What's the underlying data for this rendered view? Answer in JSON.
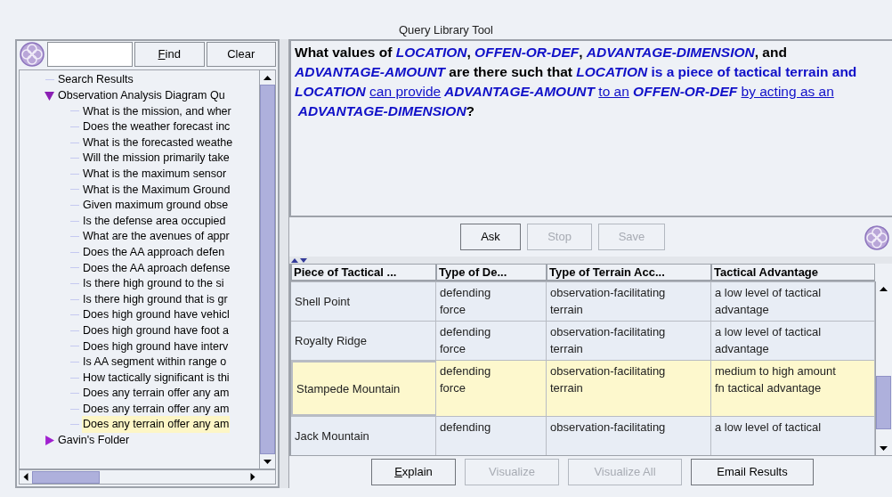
{
  "window": {
    "title": "Query Library Tool"
  },
  "search": {
    "buttons": [
      {
        "label": "Find",
        "mnemonic": true
      },
      {
        "label": "Clear",
        "mnemonic": false
      }
    ]
  },
  "tree": [
    {
      "label": "Search Results",
      "kind": "leaf",
      "selected": false
    },
    {
      "label": "Observation Analysis Diagram Qu",
      "kind": "folder",
      "expanded": true,
      "selected": false,
      "children": [
        {
          "label": "What is the mission, and wher",
          "kind": "leaf",
          "selected": false
        },
        {
          "label": "Does the weather forecast inc",
          "kind": "leaf",
          "selected": false
        },
        {
          "label": "What is the forecasted weathe",
          "kind": "leaf",
          "selected": false
        },
        {
          "label": "Will the mission primarily take",
          "kind": "leaf",
          "selected": false
        },
        {
          "label": "What is the maximum sensor",
          "kind": "leaf",
          "selected": false
        },
        {
          "label": "What is the Maximum Ground",
          "kind": "leaf",
          "selected": false
        },
        {
          "label": "Given maximum ground obse",
          "kind": "leaf",
          "selected": false
        },
        {
          "label": "Is the defense area occupied",
          "kind": "leaf",
          "selected": false
        },
        {
          "label": "What are the avenues of appr",
          "kind": "leaf",
          "selected": false
        },
        {
          "label": "Does the AA approach defen",
          "kind": "leaf",
          "selected": false
        },
        {
          "label": "Does the AA aproach defense",
          "kind": "leaf",
          "selected": false
        },
        {
          "label": "Is there high ground to the si",
          "kind": "leaf",
          "selected": false
        },
        {
          "label": "Is there high ground that is gr",
          "kind": "leaf",
          "selected": false
        },
        {
          "label": "Does high ground have vehicl",
          "kind": "leaf",
          "selected": false
        },
        {
          "label": "Does high ground have foot a",
          "kind": "leaf",
          "selected": false
        },
        {
          "label": "Does high ground have interv",
          "kind": "leaf",
          "selected": false
        },
        {
          "label": "Is AA segment within range o",
          "kind": "leaf",
          "selected": false
        },
        {
          "label": "How tactically significant is thi",
          "kind": "leaf",
          "selected": false
        },
        {
          "label": "Does any terrain offer any am",
          "kind": "leaf",
          "selected": false
        },
        {
          "label": "Does any terrain offer any am",
          "kind": "leaf",
          "selected": false
        },
        {
          "label": "Does any terrain offer any am",
          "kind": "leaf",
          "selected": true
        }
      ]
    },
    {
      "label": "Gavin's Folder",
      "kind": "folder",
      "expanded": false,
      "selected": false
    }
  ],
  "question": [
    {
      "kind": "plain",
      "text": "What values of "
    },
    {
      "kind": "variable",
      "text": "LOCATION"
    },
    {
      "kind": "plain",
      "text": ", "
    },
    {
      "kind": "variable",
      "text": "OFFEN-OR-DEF"
    },
    {
      "kind": "plain",
      "text": ", "
    },
    {
      "kind": "variable",
      "text": "ADVANTAGE-DIMENSION"
    },
    {
      "kind": "plain",
      "text": ", and "
    },
    {
      "kind": "variable",
      "text": "ADVANTAGE-AMOUNT"
    },
    {
      "kind": "plain",
      "text": " are there such that "
    },
    {
      "kind": "variable",
      "text": "LOCATION"
    },
    {
      "kind": "term",
      "text": " is a piece of tactical terrain and "
    },
    {
      "kind": "variable",
      "text": "LOCATION "
    },
    {
      "kind": "link",
      "text": "can provide"
    },
    {
      "kind": "variable",
      "text": " ADVANTAGE-AMOUNT "
    },
    {
      "kind": "link",
      "text": "to an"
    },
    {
      "kind": "variable",
      "text": " OFFEN-OR-DEF "
    },
    {
      "kind": "link",
      "text": "by acting as an"
    },
    {
      "kind": "variable",
      "text": " ADVANTAGE-DIMENSION"
    },
    {
      "kind": "plain",
      "text": "?"
    }
  ],
  "query_buttons": [
    {
      "label": "Ask",
      "disabled": false
    },
    {
      "label": "Stop",
      "disabled": true
    },
    {
      "label": "Save",
      "disabled": true
    }
  ],
  "table": {
    "columns": [
      "Piece of Tactical ...",
      "Type of De...",
      "Type of Terrain Acc...",
      "Tactical Advantage"
    ],
    "rows": [
      {
        "cells": [
          "Shell Point",
          "defending force",
          "observation-facilitating terrain",
          "a low level of tactical advantage"
        ],
        "selected": false
      },
      {
        "cells": [
          "Royalty Ridge",
          "defending force",
          "observation-facilitating terrain",
          "a low level of tactical advantage"
        ],
        "selected": false
      },
      {
        "cells": [
          "Stampede Mountain",
          "defending force",
          "observation-facilitating terrain",
          "medium to high amount fn tactical advantage"
        ],
        "selected": true
      },
      {
        "cells": [
          "Jack Mountain",
          "defending",
          "observation-facilitating",
          "a low level of tactical"
        ],
        "selected": false
      }
    ]
  },
  "result_buttons": [
    {
      "label": "Explain",
      "mnemonic": true,
      "disabled": false
    },
    {
      "label": "Visualize",
      "disabled": true
    },
    {
      "label": "Visualize All",
      "disabled": true
    },
    {
      "label": "Email Results",
      "disabled": false
    }
  ]
}
